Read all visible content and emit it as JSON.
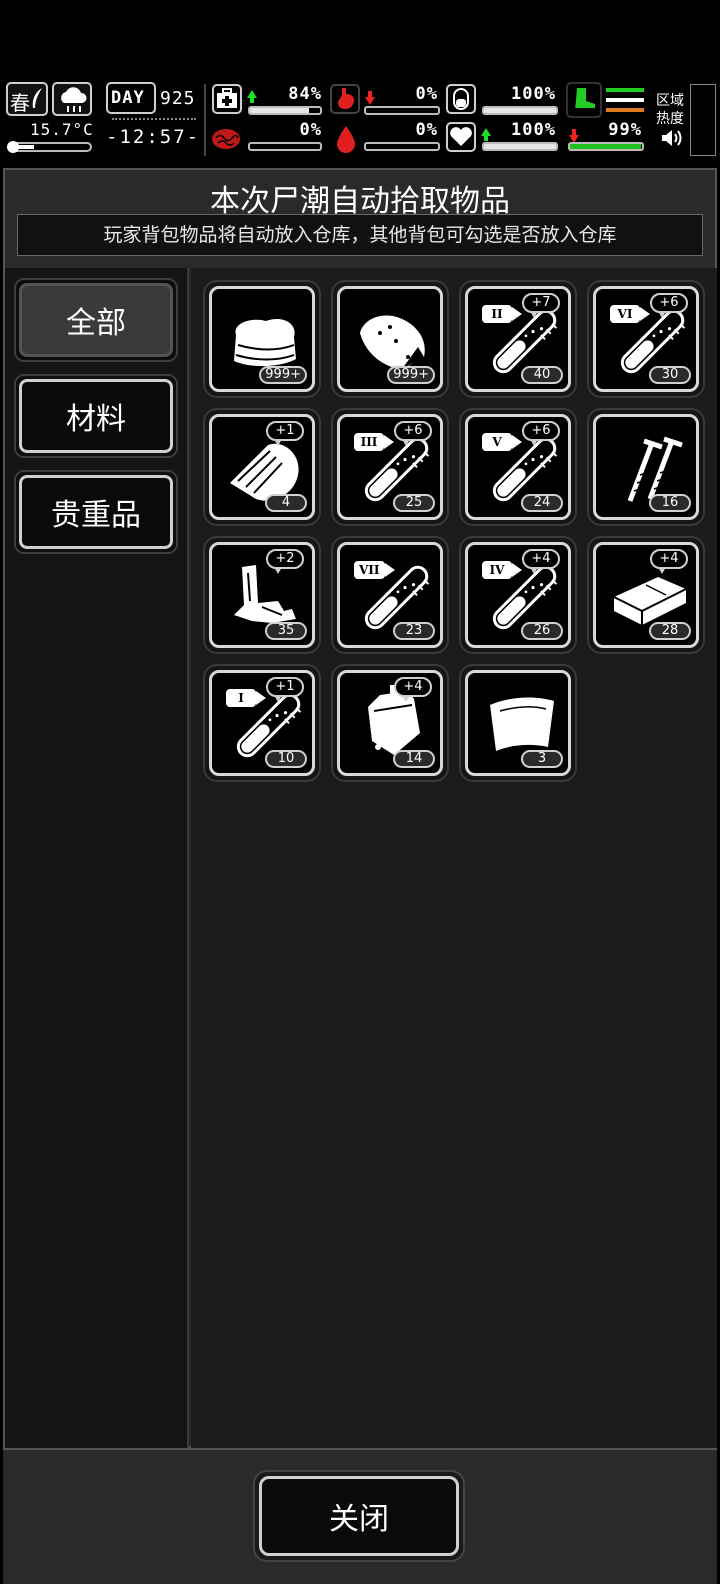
{
  "hud": {
    "season": "春",
    "temperature": "15.7°C",
    "day_label": "DAY",
    "day_number": "925",
    "clock": "-12:57-",
    "stats": [
      {
        "id": "health",
        "icon": "medkit-icon",
        "trend": "up",
        "value": "84%",
        "level": 0.84
      },
      {
        "id": "hunger",
        "icon": "stomach-icon",
        "trend": "down",
        "value": "0%",
        "level": 0.0
      },
      {
        "id": "stamina",
        "icon": "capsule-icon",
        "trend": "none",
        "value": "100%",
        "level": 1.0
      },
      {
        "id": "infection",
        "icon": "brain-icon",
        "trend": "none",
        "value": "0%",
        "level": 0.0
      },
      {
        "id": "thirst",
        "icon": "blood-drop-icon",
        "trend": "none",
        "value": "0%",
        "level": 0.0
      },
      {
        "id": "mood",
        "icon": "heart-icon",
        "trend": "up",
        "value": "100%",
        "level": 1.0
      },
      {
        "id": "endurance",
        "icon": "boot-icon",
        "trend": "down",
        "value": "99%",
        "level": 0.99
      }
    ],
    "zone_heat_label_1": "区域",
    "zone_heat_label_2": "热度",
    "colors": {
      "up": "#22dd22",
      "down": "#ee2222",
      "endurance_bar": "#20c020"
    }
  },
  "dialog": {
    "title": "本次尸潮自动拾取物品",
    "notice": "玩家背包物品将自动放入仓库，其他背包可勾选是否放入仓库",
    "tabs": [
      {
        "label": "全部",
        "active": true
      },
      {
        "label": "材料",
        "active": false
      },
      {
        "label": "贵重品",
        "active": false
      }
    ],
    "items": [
      {
        "icon": "cloth-icon",
        "count": "999+",
        "bonus": "",
        "tier": ""
      },
      {
        "icon": "meat-icon",
        "count": "999+",
        "bonus": "",
        "tier": ""
      },
      {
        "icon": "test-tube-icon",
        "count": "40",
        "bonus": "+7",
        "tier": "II"
      },
      {
        "icon": "test-tube-icon",
        "count": "30",
        "bonus": "+6",
        "tier": "VI"
      },
      {
        "icon": "wood-plank-icon",
        "count": "4",
        "bonus": "+1",
        "tier": ""
      },
      {
        "icon": "test-tube-icon",
        "count": "25",
        "bonus": "+6",
        "tier": "III"
      },
      {
        "icon": "test-tube-icon",
        "count": "24",
        "bonus": "+6",
        "tier": "V"
      },
      {
        "icon": "nails-icon",
        "count": "16",
        "bonus": "",
        "tier": ""
      },
      {
        "icon": "scrap-metal-icon",
        "count": "35",
        "bonus": "+2",
        "tier": ""
      },
      {
        "icon": "test-tube-icon",
        "count": "23",
        "bonus": "",
        "tier": "VII"
      },
      {
        "icon": "test-tube-icon",
        "count": "26",
        "bonus": "+4",
        "tier": "IV"
      },
      {
        "icon": "brick-icon",
        "count": "28",
        "bonus": "+4",
        "tier": ""
      },
      {
        "icon": "test-tube-icon",
        "count": "10",
        "bonus": "+1",
        "tier": "I"
      },
      {
        "icon": "blood-bag-icon",
        "count": "14",
        "bonus": "+4",
        "tier": ""
      },
      {
        "icon": "metal-sheet-icon",
        "count": "3",
        "bonus": "",
        "tier": ""
      }
    ],
    "close_label": "关闭"
  }
}
